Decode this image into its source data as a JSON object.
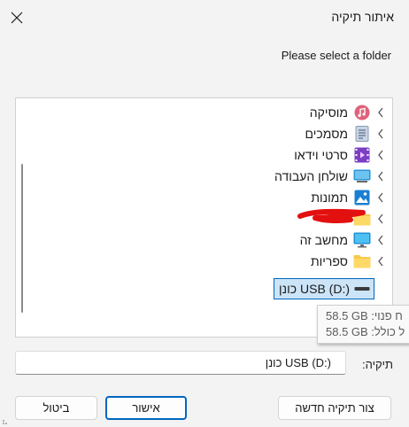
{
  "window": {
    "title": "איתור תיקיה"
  },
  "prompt": "Please select a folder",
  "tree": {
    "items": [
      {
        "label": "מוסיקה",
        "icon": "music-icon"
      },
      {
        "label": "מסמכים",
        "icon": "documents-icon"
      },
      {
        "label": "סרטי וידאו",
        "icon": "videos-icon"
      },
      {
        "label": "שולחן העבודה",
        "icon": "desktop-icon"
      },
      {
        "label": "תמונות",
        "icon": "pictures-icon"
      },
      {
        "label": "",
        "icon": "folder-icon"
      },
      {
        "label": "מחשב זה",
        "icon": "this-pc-icon"
      },
      {
        "label": "ספריות",
        "icon": "libraries-icon"
      },
      {
        "label": "USB (D:) כונן",
        "icon": "drive-icon",
        "selected": true
      }
    ]
  },
  "tooltip": {
    "line1": "58.5 GB :ח פנוי",
    "line2": "58.5 GB :ל כולל"
  },
  "folder_field": {
    "label": "תיקיה:",
    "value": "USB (D:) כונן"
  },
  "buttons": {
    "new_folder": "צור תיקיה חדשה",
    "ok": "אישור",
    "cancel": "ביטול"
  },
  "colors": {
    "accent": "#0067c0",
    "selection": "#cce4f7",
    "scribble": "#e31010"
  }
}
